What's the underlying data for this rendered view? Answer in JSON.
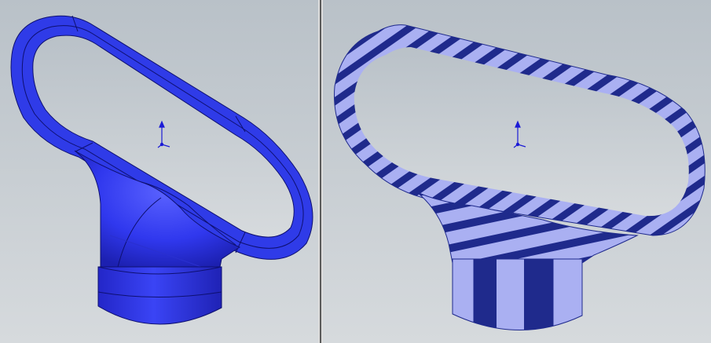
{
  "window": {
    "layout": "two-viewport-split"
  },
  "viewports": [
    {
      "id": "left",
      "display_style": "shaded-with-edges",
      "model": "handle-part",
      "color": "#2f3be8"
    },
    {
      "id": "right",
      "display_style": "zebra-stripes",
      "model": "handle-part",
      "stripe_dark": "#1f2a8c",
      "stripe_light": "#aab0f2"
    }
  ],
  "colors": {
    "background_top": "#b9c1c8",
    "background_bottom": "#d6dadd",
    "triad_axis": "#1b1bd6",
    "splitter": "#5a5a5a"
  },
  "icons": [
    "origin-triad-icon"
  ]
}
